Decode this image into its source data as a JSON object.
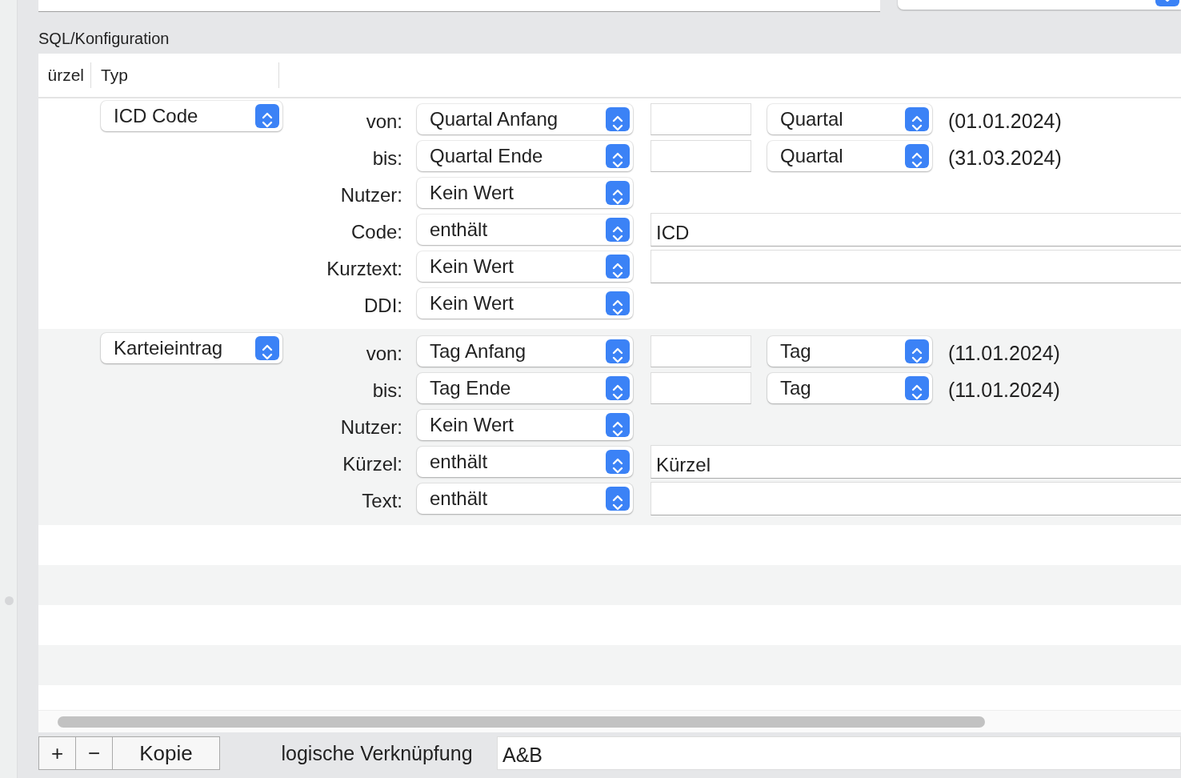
{
  "section_title": "SQL/Konfiguration",
  "table": {
    "columns": [
      "ürzel",
      "Typ"
    ],
    "rows": [
      {
        "type": "ICD Code",
        "conditions": [
          {
            "kind": "date",
            "label": "von:",
            "operator": "Quartal Anfang",
            "unit": "Quartal",
            "date": "(01.01.2024)"
          },
          {
            "kind": "date",
            "label": "bis:",
            "operator": "Quartal Ende",
            "unit": "Quartal",
            "date": "(31.03.2024)"
          },
          {
            "kind": "plain",
            "label": "Nutzer:",
            "operator": "Kein Wert"
          },
          {
            "kind": "text",
            "label": "Code:",
            "operator": "enthält",
            "value": "ICD"
          },
          {
            "kind": "text",
            "label": "Kurztext:",
            "operator": "Kein Wert"
          },
          {
            "kind": "plain",
            "label": "DDI:",
            "operator": "Kein Wert"
          }
        ]
      },
      {
        "type": "Karteieintrag",
        "conditions": [
          {
            "kind": "date",
            "label": "von:",
            "operator": "Tag Anfang",
            "unit": "Tag",
            "date": "(11.01.2024)"
          },
          {
            "kind": "date",
            "label": "bis:",
            "operator": "Tag Ende",
            "unit": "Tag",
            "date": "(11.01.2024)"
          },
          {
            "kind": "plain",
            "label": "Nutzer:",
            "operator": "Kein Wert"
          },
          {
            "kind": "text",
            "label": "Kürzel:",
            "operator": "enthält",
            "value": "Kürzel"
          },
          {
            "kind": "text",
            "label": "Text:",
            "operator": "enthält"
          }
        ]
      }
    ]
  },
  "footer": {
    "buttons": [
      "+",
      "−",
      "Kopie"
    ],
    "logic_label": "logische Verknüpfung",
    "logic_value": "A&B"
  }
}
